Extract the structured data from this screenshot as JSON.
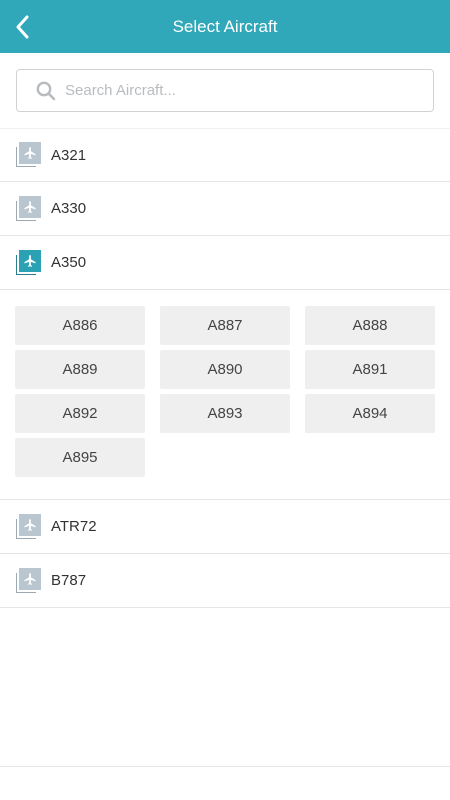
{
  "header": {
    "title": "Select Aircraft",
    "back_icon": "chevron-left-icon",
    "color": "#31a8b9"
  },
  "search": {
    "placeholder": "Search Aircraft...",
    "value": "",
    "icon": "search-icon"
  },
  "aircraft_types": [
    {
      "label": "A321",
      "expanded": false
    },
    {
      "label": "A330",
      "expanded": false
    },
    {
      "label": "A350",
      "expanded": true,
      "registrations": [
        "A886",
        "A887",
        "A888",
        "A889",
        "A890",
        "A891",
        "A892",
        "A893",
        "A894",
        "A895"
      ]
    },
    {
      "label": "ATR72",
      "expanded": false
    },
    {
      "label": "B787",
      "expanded": false
    }
  ],
  "colors": {
    "accent": "#2ba2b4",
    "icon_inactive": "#b9c6cf",
    "tile_bg": "#efefef"
  }
}
